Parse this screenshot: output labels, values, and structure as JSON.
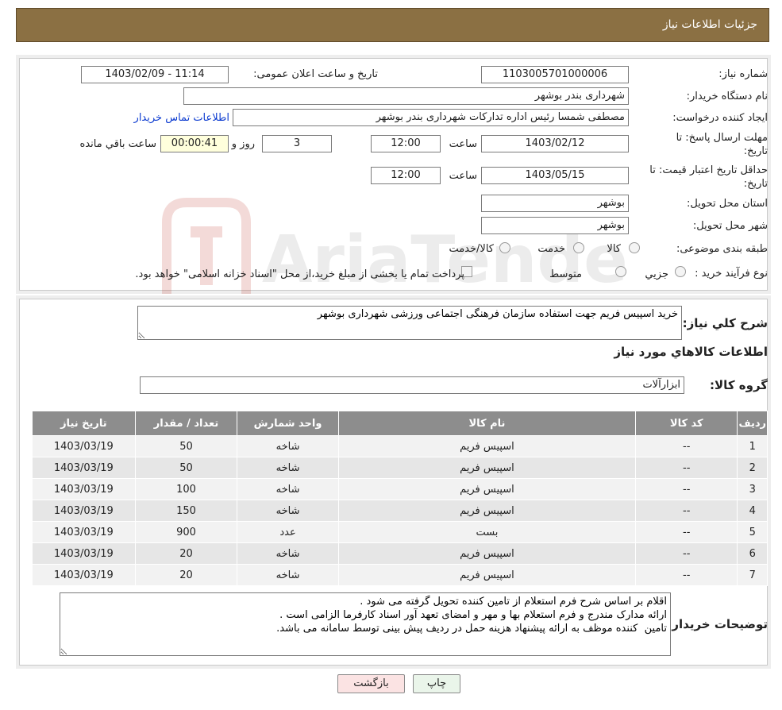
{
  "header": {
    "title": "جزئیات اطلاعات نیاز"
  },
  "form": {
    "need_number_label": "شماره نیاز:",
    "need_number": "1103005701000006",
    "announce_label": "تاریخ و ساعت اعلان عمومی:",
    "announce_value": "1403/02/09 - 11:14",
    "buyer_org_label": "نام دستگاه خریدار:",
    "buyer_org": "شهرداری بندر بوشهر",
    "creator_label": "ایجاد کننده درخواست:",
    "creator": "مصطفی شمسا رئیس اداره تدارکات  شهرداری بندر بوشهر",
    "contact_link": "اطلاعات تماس خریدار",
    "deadline_label_1": "مهلت ارسال پاسخ: تا",
    "deadline_label_2": "تاریخ:",
    "deadline_date": "1403/02/12",
    "time_label": "ساعت",
    "deadline_time": "12:00",
    "days": "3",
    "days_label": "روز و",
    "remaining": "00:00:41",
    "remaining_label": "ساعت باقي مانده",
    "validity_label_1": "حداقل تاریخ اعتبار قیمت: تا",
    "validity_label_2": "تاریخ:",
    "validity_date": "1403/05/15",
    "validity_time": "12:00",
    "province_label": "استان محل تحویل:",
    "province": "بوشهر",
    "city_label": "شهر محل تحویل:",
    "city": "بوشهر",
    "category_label": "طبقه بندی موضوعی:",
    "category_options": [
      "کالا",
      "خدمت",
      "کالا/خدمت"
    ],
    "process_label": "نوع فرآیند خرید :",
    "process_options": [
      "جزیي",
      "متوسط"
    ],
    "process_note": "پرداخت تمام یا بخشی از مبلغ خرید،از محل \"اسناد خزانه اسلامی\" خواهد بود."
  },
  "detail": {
    "summary_label": "شرح کلي نیاز:",
    "summary": "خرید اسپیس فریم جهت استفاده سازمان فرهنگی اجتماعی ورزشی شهرداری بوشهر",
    "items_heading": "اطلاعات کالاهاي مورد نیاز",
    "group_label": "گروه کالا:",
    "group": "ابزارآلات",
    "table": {
      "headers": [
        "ردیف",
        "کد کالا",
        "نام کالا",
        "واحد شمارش",
        "تعداد / مقدار",
        "تاریخ نیاز"
      ],
      "rows": [
        [
          "1",
          "--",
          "اسپیس فریم",
          "شاخه",
          "50",
          "1403/03/19"
        ],
        [
          "2",
          "--",
          "اسپیس فریم",
          "شاخه",
          "50",
          "1403/03/19"
        ],
        [
          "3",
          "--",
          "اسپیس فریم",
          "شاخه",
          "100",
          "1403/03/19"
        ],
        [
          "4",
          "--",
          "اسپیس فریم",
          "شاخه",
          "150",
          "1403/03/19"
        ],
        [
          "5",
          "--",
          "بست",
          "عدد",
          "900",
          "1403/03/19"
        ],
        [
          "6",
          "--",
          "اسپیس فریم",
          "شاخه",
          "20",
          "1403/03/19"
        ],
        [
          "7",
          "--",
          "اسپیس فریم",
          "شاخه",
          "20",
          "1403/03/19"
        ]
      ]
    },
    "buyer_notes_label": "توضیحات خریدار:",
    "buyer_notes": "اقلام بر اساس شرح فرم استعلام از تامین کننده تحویل گرفته می شود .\nارائه مدارک مندرج و فرم استعلام بها و مهر و امضای تعهد آور اسناد کارفرما الزامی است .\nتامین  کننده موظف به ارائه پیشنهاد هزینه حمل در ردیف پیش بینی توسط سامانه می باشد."
  },
  "buttons": {
    "print": "چاپ",
    "back": "بازگشت"
  },
  "watermark": {
    "text": "AriaTender.neT"
  },
  "colors": {
    "header_bg": "#8b7043",
    "table_header": "#8d8d8d",
    "back_btn": "#fbe3e3",
    "link": "#0c3bd0"
  }
}
